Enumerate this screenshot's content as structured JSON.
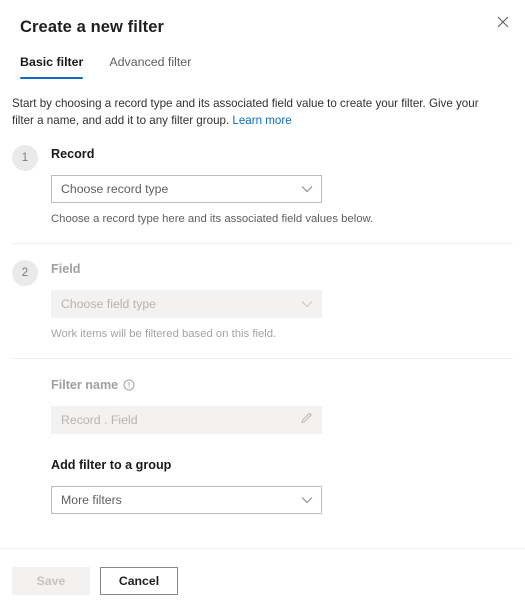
{
  "header": {
    "title": "Create a new filter",
    "close_icon": "close-icon"
  },
  "tabs": [
    {
      "label": "Basic filter",
      "active": true
    },
    {
      "label": "Advanced filter",
      "active": false
    }
  ],
  "intro": {
    "text": "Start by choosing a record type and its associated field value to create your filter. Give your filter a name, and add it to any filter group. ",
    "link_label": "Learn more"
  },
  "steps": [
    {
      "number": "1",
      "label": "Record",
      "dropdown": {
        "value": "Choose record type",
        "placeholder": "Choose record type",
        "icon": "chevron-down-icon",
        "disabled": false
      },
      "hint": "Choose a record type here and its associated field values below.",
      "disabled": false
    },
    {
      "number": "2",
      "label": "Field",
      "dropdown": {
        "value": "Choose field type",
        "placeholder": "Choose field type",
        "icon": "chevron-down-icon",
        "disabled": true
      },
      "hint": "Work items will be filtered based on this field.",
      "disabled": true
    }
  ],
  "filter_name": {
    "label": "Filter name",
    "info_icon": "info-icon",
    "value": "Record . Field",
    "placeholder": "Record . Field",
    "edit_icon": "pencil-icon",
    "disabled": true
  },
  "filter_group": {
    "label": "Add filter to a group",
    "dropdown": {
      "value": "More filters",
      "placeholder": "More filters",
      "icon": "chevron-down-icon"
    }
  },
  "footer": {
    "save_label": "Save",
    "save_disabled": true,
    "cancel_label": "Cancel"
  },
  "colors": {
    "accent": "#0f6cbd",
    "link": "#0f6cbd",
    "text": "#323130",
    "muted_text": "#605e5c",
    "disabled_text": "#b6b4b2",
    "disabled_fill": "#f3f2f1",
    "badge_fill": "#eaeaea",
    "border": "#bdbdbd",
    "divider": "#f0f0f0"
  }
}
